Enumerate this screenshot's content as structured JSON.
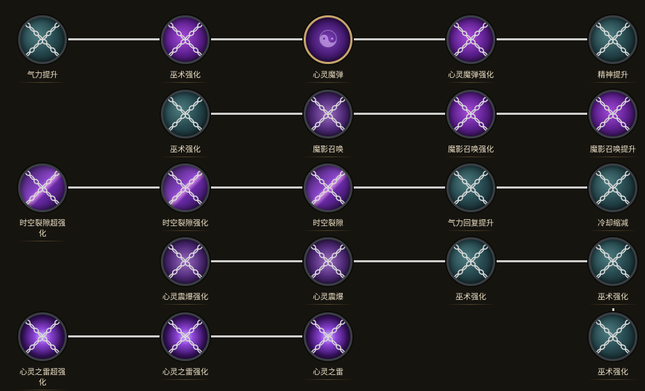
{
  "skill_tree": {
    "rows": [
      [
        {
          "label": "气力提升",
          "icon": "chained-teal-orb-icon",
          "style": "teal",
          "locked": true
        },
        {
          "label": "巫术强化",
          "icon": "chained-purple-vortex-icon",
          "style": "purple",
          "locked": true
        },
        {
          "label": "心灵魔弹",
          "icon": "psychic-bolt-icon",
          "style": "violet",
          "locked": false
        },
        {
          "label": "心灵魔弹强化",
          "icon": "chained-purple-vortex-icon",
          "style": "purple",
          "locked": true
        },
        {
          "label": "精神提升",
          "icon": "chained-teal-orb-icon",
          "style": "teal",
          "locked": true
        }
      ],
      [
        null,
        {
          "label": "巫术强化",
          "icon": "chained-teal-orb-icon",
          "style": "teal",
          "locked": true
        },
        {
          "label": "魔影召唤",
          "icon": "chained-shadow-summon-icon",
          "style": "mark",
          "locked": true
        },
        {
          "label": "魔影召唤强化",
          "icon": "chained-shadow-summon-icon",
          "style": "purple",
          "locked": true
        },
        {
          "label": "魔影召唤提升",
          "icon": "chained-shadow-summon-icon",
          "style": "purple",
          "locked": true
        }
      ],
      [
        {
          "label": "时空裂隙超强化",
          "icon": "chained-rift-icon",
          "style": "rift",
          "locked": true
        },
        {
          "label": "时空裂隙强化",
          "icon": "chained-rift-icon",
          "style": "rift",
          "locked": true
        },
        {
          "label": "时空裂隙",
          "icon": "chained-rift-icon",
          "style": "rift",
          "locked": true
        },
        {
          "label": "气力回复提升",
          "icon": "chained-teal-orb-icon",
          "style": "teal",
          "locked": true
        },
        {
          "label": "冷却缩减",
          "icon": "chained-teal-orb-icon",
          "style": "teal",
          "locked": true
        }
      ],
      [
        null,
        {
          "label": "心灵震爆强化",
          "icon": "chained-psychic-blast-icon",
          "style": "mark",
          "locked": true
        },
        {
          "label": "心灵震爆",
          "icon": "chained-psychic-blast-icon",
          "style": "mark",
          "locked": true
        },
        {
          "label": "巫术强化",
          "icon": "chained-teal-orb-icon",
          "style": "teal",
          "locked": true
        },
        {
          "label": "巫术强化",
          "icon": "chained-teal-orb-icon",
          "style": "teal",
          "locked": true
        }
      ],
      [
        {
          "label": "心灵之雷超强化",
          "icon": "chained-mind-thunder-icon",
          "style": "spark",
          "locked": true
        },
        {
          "label": "心灵之雷强化",
          "icon": "chained-mind-thunder-icon",
          "style": "spark",
          "locked": true
        },
        {
          "label": "心灵之雷",
          "icon": "chained-mind-thunder-icon",
          "style": "spark",
          "locked": true
        },
        null,
        {
          "label": "巫术强化",
          "icon": "chained-teal-orb-icon",
          "style": "teal",
          "locked": true
        }
      ]
    ],
    "colors": {
      "background": "#16140f",
      "link": "#cfcfcf",
      "label": "#e8dcc2",
      "active_ring": "#c8a56a"
    }
  }
}
